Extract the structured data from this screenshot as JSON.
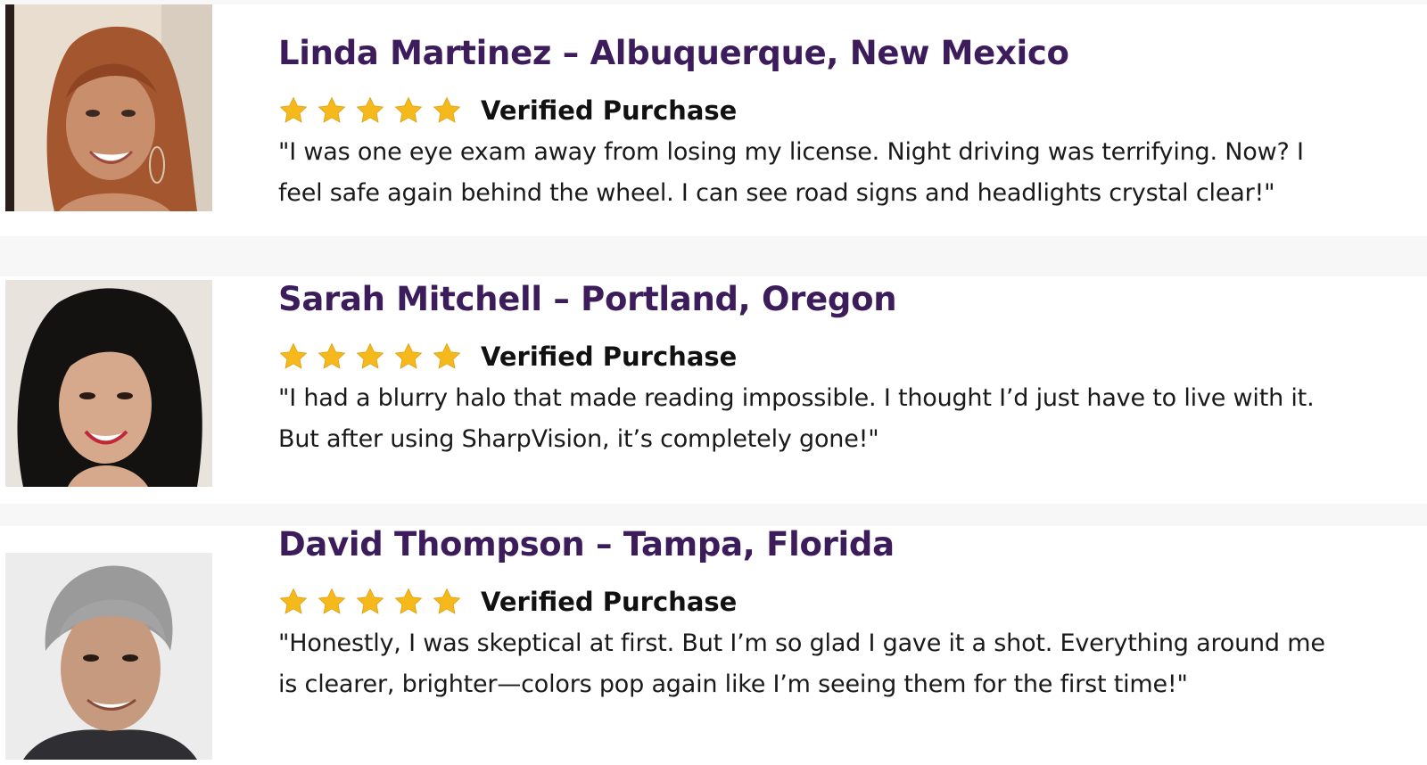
{
  "reviews": [
    {
      "name": "Linda Martinez – Albuquerque, New Mexico",
      "rating": 5,
      "badge": "Verified Purchase",
      "quote": "\"I was one eye exam away from losing my license. Night driving was terrifying. Now? I feel safe again behind the wheel. I can see road signs and headlights crystal clear!\""
    },
    {
      "name": "Sarah Mitchell – Portland, Oregon",
      "rating": 5,
      "badge": "Verified Purchase",
      "quote": "\"I had a blurry halo that made reading impossible. I thought I’d just have to live with it. But after using SharpVision, it’s completely gone!\""
    },
    {
      "name": "David Thompson – Tampa, Florida",
      "rating": 5,
      "badge": "Verified Purchase",
      "quote": " \"Honestly, I was skeptical at first. But I’m so glad I gave it a shot. Everything around me is clearer, brighter—colors pop again like I’m seeing them for the first time!\""
    }
  ],
  "colors": {
    "name": "#3d1c5c",
    "star": "#f5b91c",
    "text": "#1a1a1a"
  },
  "icons": {
    "star": "star-icon"
  }
}
